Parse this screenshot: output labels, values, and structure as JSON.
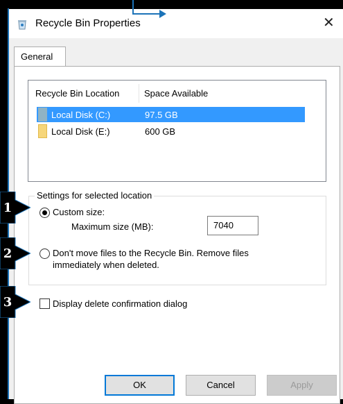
{
  "window": {
    "title": "Recycle Bin Properties",
    "close_glyph": "✕"
  },
  "tabs": [
    {
      "label": "General"
    }
  ],
  "drive_list": {
    "columns": [
      "Recycle Bin Location",
      "Space Available"
    ],
    "rows": [
      {
        "location": "Local Disk (C:)",
        "space": "97.5 GB",
        "selected": true,
        "icon": "drive-c-icon"
      },
      {
        "location": "Local Disk (E:)",
        "space": "600 GB",
        "selected": false,
        "icon": "drive-e-icon"
      }
    ]
  },
  "settings": {
    "group_label": "Settings for selected location",
    "custom_size_label": "Custom size:",
    "max_size_label": "Maximum size (MB):",
    "max_size_value": "7040",
    "no_recycle_label_line1": "Don't move files to the Recycle Bin. Remove files",
    "no_recycle_label_line2": "immediately when deleted.",
    "custom_size_selected": true
  },
  "confirm_dialog": {
    "label": "Display delete confirmation dialog",
    "checked": false
  },
  "buttons": {
    "ok": "OK",
    "cancel": "Cancel",
    "apply": "Apply"
  },
  "annotations": {
    "badge_1": "1",
    "badge_2": "2",
    "badge_3": "3"
  },
  "colors": {
    "selection": "#3399ff",
    "annotation_arrow": "#1b73b8",
    "ok_focus": "#0078d7"
  }
}
